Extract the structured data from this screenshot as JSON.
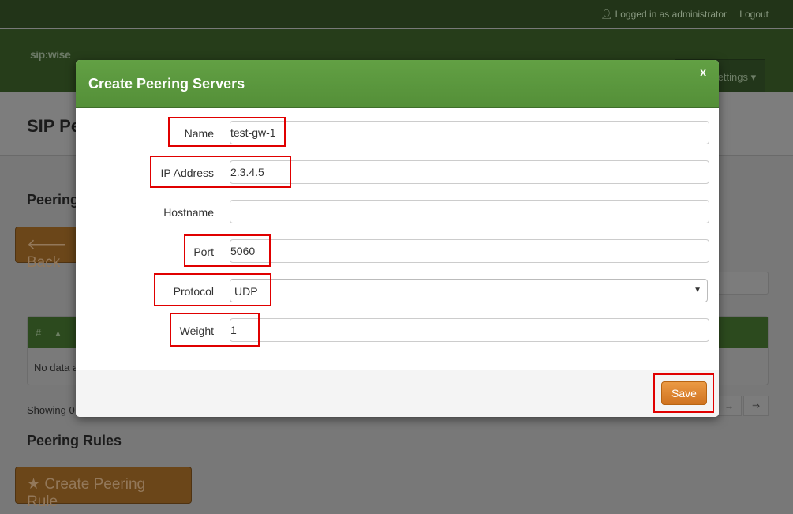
{
  "topbar": {
    "user": "Logged in as administrator",
    "logout": "Logout"
  },
  "nav": {
    "logo": "sip:wise",
    "menu": "Settings"
  },
  "page": {
    "title": "SIP Pe",
    "section1": "Peering",
    "back": "Back",
    "table_first_col": "#",
    "no_data": "No data a",
    "showing": "Showing 0",
    "section2": "Peering Rules",
    "create_rule": "Create Peering Rule",
    "pager": [
      "→",
      "⇒"
    ]
  },
  "modal": {
    "title": "Create Peering Servers",
    "close": "x",
    "fields": [
      {
        "label": "Name",
        "value": "test-gw-1"
      },
      {
        "label": "IP Address",
        "value": "2.3.4.5"
      },
      {
        "label": "Hostname",
        "value": ""
      },
      {
        "label": "Port",
        "value": "5060"
      },
      {
        "label": "Protocol",
        "value": "UDP"
      },
      {
        "label": "Weight",
        "value": "1"
      }
    ],
    "save": "Save"
  },
  "colors": {
    "accent": "#5a9a3e",
    "save": "#de8530",
    "highlight": "#e00000"
  }
}
